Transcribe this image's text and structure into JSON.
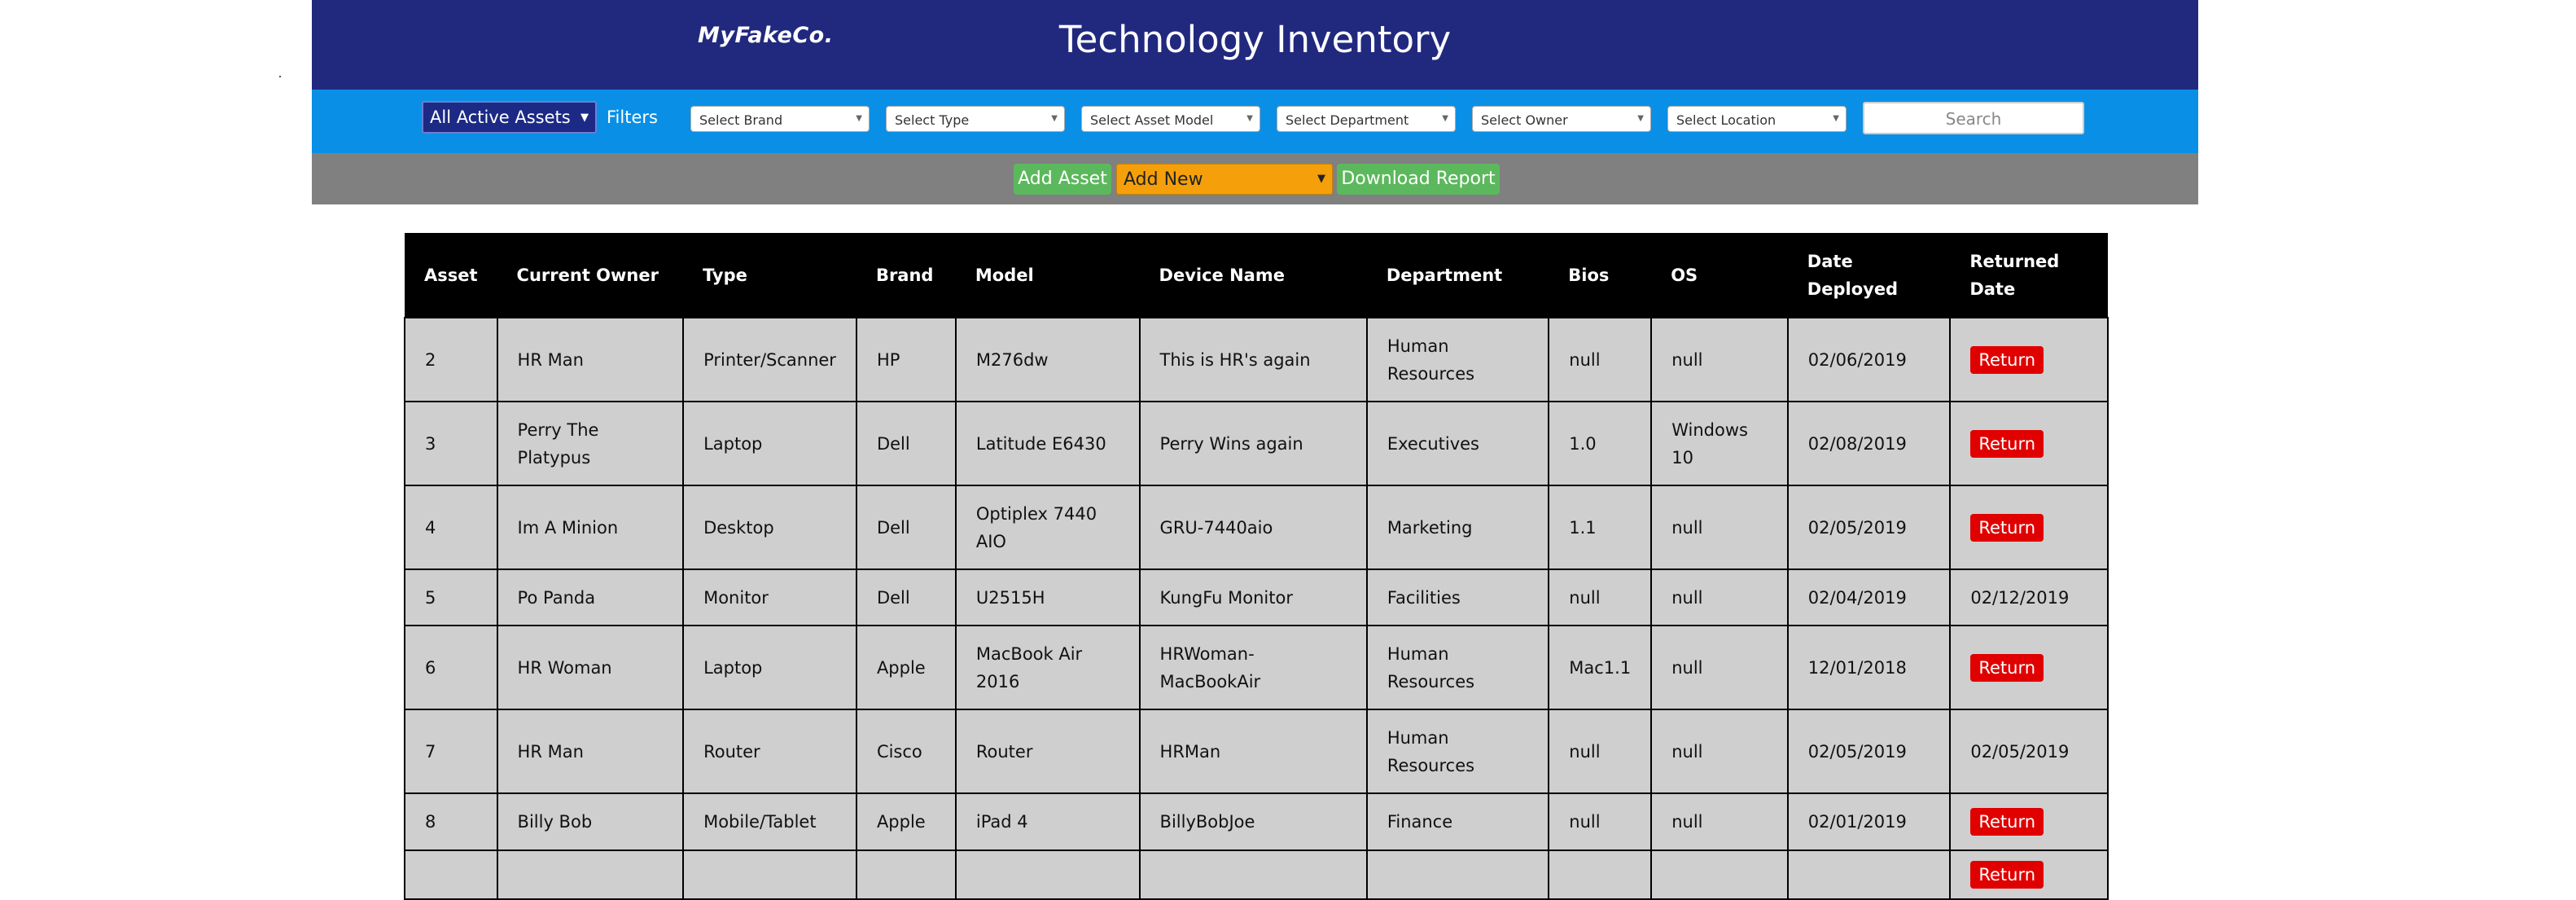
{
  "header": {
    "logo": "MyFakeCo.",
    "title": "Technology Inventory"
  },
  "filters": {
    "scope": "All Active Assets",
    "label": "Filters",
    "selects": [
      "Select Brand",
      "Select Type",
      "Select Asset Model",
      "Select Department",
      "Select Owner",
      "Select Location"
    ],
    "search_placeholder": "Search"
  },
  "actions": {
    "add_asset": "Add Asset",
    "add_new": "Add New",
    "download_report": "Download Report"
  },
  "table": {
    "columns": [
      "Asset",
      "Current Owner",
      "Type",
      "Brand",
      "Model",
      "Device Name",
      "Department",
      "Bios",
      "OS",
      "Date Deployed",
      "Returned Date"
    ],
    "rows": [
      {
        "asset": "2",
        "owner": "HR Man",
        "type": "Printer/Scanner",
        "brand": "HP",
        "model": "M276dw",
        "device": "This is HR's again",
        "department": "Human Resources",
        "bios": "null",
        "os": "null",
        "deployed": "02/06/2019",
        "returned": "Return"
      },
      {
        "asset": "3",
        "owner": "Perry The Platypus",
        "type": "Laptop",
        "brand": "Dell",
        "model": "Latitude E6430",
        "device": "Perry Wins again",
        "department": "Executives",
        "bios": "1.0",
        "os": "Windows 10",
        "deployed": "02/08/2019",
        "returned": "Return"
      },
      {
        "asset": "4",
        "owner": "Im A Minion",
        "type": "Desktop",
        "brand": "Dell",
        "model": "Optiplex 7440 AIO",
        "device": "GRU-7440aio",
        "department": "Marketing",
        "bios": "1.1",
        "os": "null",
        "deployed": "02/05/2019",
        "returned": "Return"
      },
      {
        "asset": "5",
        "owner": "Po Panda",
        "type": "Monitor",
        "brand": "Dell",
        "model": "U2515H",
        "device": "KungFu Monitor",
        "department": "Facilities",
        "bios": "null",
        "os": "null",
        "deployed": "02/04/2019",
        "returned": "02/12/2019"
      },
      {
        "asset": "6",
        "owner": "HR Woman",
        "type": "Laptop",
        "brand": "Apple",
        "model": "MacBook Air 2016",
        "device": "HRWoman-MacBookAir",
        "department": "Human Resources",
        "bios": "Mac1.1",
        "os": "null",
        "deployed": "12/01/2018",
        "returned": "Return"
      },
      {
        "asset": "7",
        "owner": "HR Man",
        "type": "Router",
        "brand": "Cisco",
        "model": "Router",
        "device": "HRMan",
        "department": "Human Resources",
        "bios": "null",
        "os": "null",
        "deployed": "02/05/2019",
        "returned": "02/05/2019"
      },
      {
        "asset": "8",
        "owner": "Billy Bob",
        "type": "Mobile/Tablet",
        "brand": "Apple",
        "model": "iPad 4",
        "device": "BillyBobJoe",
        "department": "Finance",
        "bios": "null",
        "os": "null",
        "deployed": "02/01/2019",
        "returned": "Return"
      },
      {
        "asset": "",
        "owner": "",
        "type": "",
        "brand": "",
        "model": "",
        "device": "",
        "department": "",
        "bios": "",
        "os": "",
        "deployed": "",
        "returned": "Return"
      }
    ]
  }
}
